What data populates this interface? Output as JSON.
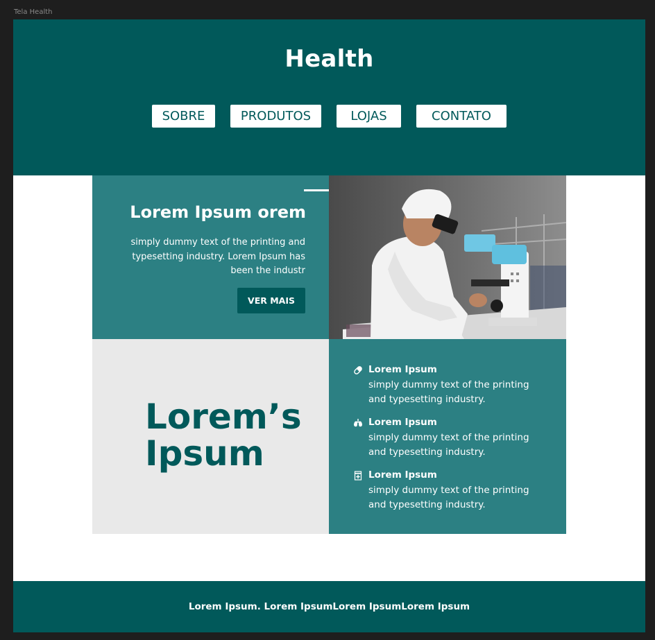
{
  "frame_label": "Tela Health",
  "header": {
    "brand": "Health",
    "nav": [
      "SOBRE",
      "PRODUTOS",
      "LOJAS",
      "CONTATO"
    ]
  },
  "hero": {
    "title": "Lorem Ipsum orem",
    "body": "simply dummy text of the printing and typesetting industry. Lorem Ipsum has been the industr",
    "button": "VER MAIS"
  },
  "section": {
    "big_title_line1": "Lorem’s",
    "big_title_line2": "Ipsum",
    "features": [
      {
        "icon": "pill-icon",
        "title": "Lorem Ipsum",
        "body": "simply dummy text of the printing and typesetting industry."
      },
      {
        "icon": "lungs-icon",
        "title": "Lorem Ipsum",
        "body": "simply dummy text of the printing and typesetting industry."
      },
      {
        "icon": "medicine-bottle-icon",
        "title": "Lorem Ipsum",
        "body": "simply dummy text of the printing and typesetting industry."
      }
    ]
  },
  "footer": {
    "text": "Lorem Ipsum. Lorem IpsumLorem IpsumLorem Ipsum"
  },
  "colors": {
    "primary": "#01595a",
    "secondary": "#2c8083",
    "light_panel": "#e9e9e9",
    "canvas": "#1e1e1e"
  }
}
